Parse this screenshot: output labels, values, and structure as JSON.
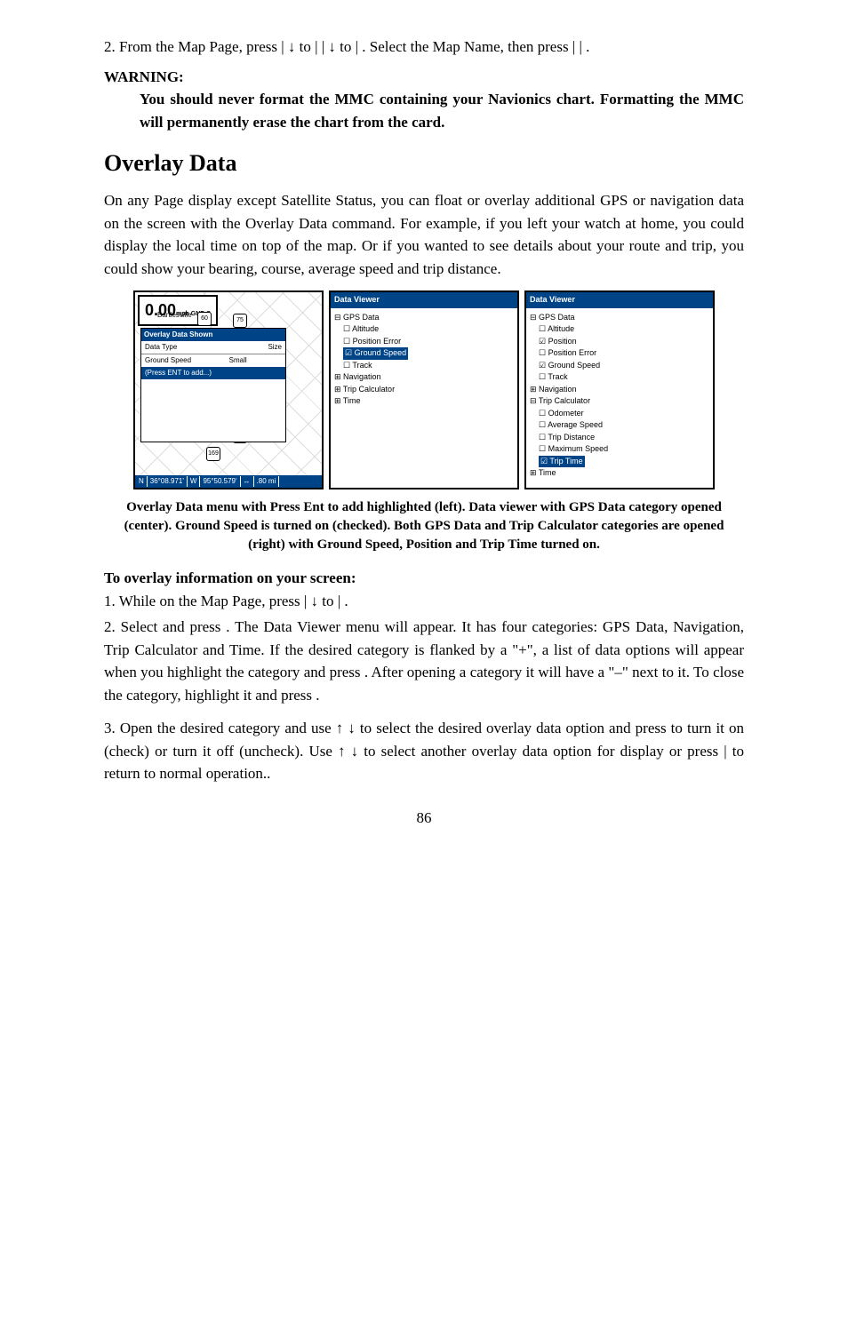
{
  "step2": "2. From the Map Page, press | ↓ to | | ↓ to | . Select the Map Name, then press | | .",
  "warningLabel": "WARNING:",
  "warningText": "You should never format the MMC containing your Navionics chart. Formatting the MMC will permanently erase the chart from the card.",
  "heading": "Overlay Data",
  "intro": "On any Page display except Satellite Status, you can float or overlay additional GPS or navigation data on the screen with the Overlay Data command. For example, if you left your watch at home, you could display the local time on top of the map. Or if you wanted to see details about your route and trip, you could show your bearing, course, average speed and trip distance.",
  "shot1": {
    "speedNum": "0.00",
    "speedUnit": "mph GND.S",
    "townLabel": "Bartlesville",
    "overlayTitle": "Overlay Data Shown",
    "colType": "Data Type",
    "colSize": "Size",
    "rowType": "Ground Speed",
    "rowSize": "Small",
    "pressAdd": "(Press ENT to add...)",
    "statusN": "N",
    "statusLat": "36°08.971'",
    "statusW": "W",
    "statusLon": "95°50.579'",
    "statusArrows": "↔",
    "statusDist": ".80 mi",
    "sign1": "60",
    "sign2": "75",
    "sign3": "169",
    "sign4": "60"
  },
  "shot2": {
    "title": "Data Viewer",
    "nodes": [
      "⊟ GPS Data",
      "    ☐ Altitude",
      "    ☐ Position Error",
      "    ☑ Ground Speed",
      "    ☐ Track",
      "⊞ Navigation",
      "⊞ Trip Calculator",
      "⊞ Time"
    ],
    "selIndex": 3
  },
  "shot3": {
    "title": "Data Viewer",
    "nodes": [
      "⊟ GPS Data",
      "    ☐ Altitude",
      "    ☑ Position",
      "    ☐ Position Error",
      "    ☑ Ground Speed",
      "    ☐ Track",
      "⊞ Navigation",
      "⊟ Trip Calculator",
      "    ☐ Odometer",
      "    ☐ Average Speed",
      "    ☐ Trip Distance",
      "    ☐ Maximum Speed",
      "    ☑ Trip Time",
      "⊞ Time"
    ],
    "selIndex": 12
  },
  "caption": "Overlay Data menu with Press Ent to add highlighted (left). Data viewer with GPS Data category opened (center). Ground Speed is turned on (checked). Both GPS Data and Trip Calculator categories are opened (right) with Ground Speed, Position and Trip Time turned on.",
  "subHead": "To overlay information on your screen:",
  "proc1": "1. While on the Map Page, press | ↓ to | .",
  "proc2": "2. Select and press . The Data Viewer menu will appear. It has four categories: GPS Data, Navigation, Trip Calculator and Time. If the desired category is flanked by a \"+\", a list of data options will appear when you highlight the category and press . After opening a category it will have a \"–\" next to it. To close the category, highlight it and press .",
  "proc3": "3. Open the desired category and use ↑ ↓ to select the desired overlay data option and press to turn it on (check) or turn it off (uncheck). Use ↑ ↓ to select another overlay data option for display or press | to return to normal operation..",
  "pageNum": "86"
}
